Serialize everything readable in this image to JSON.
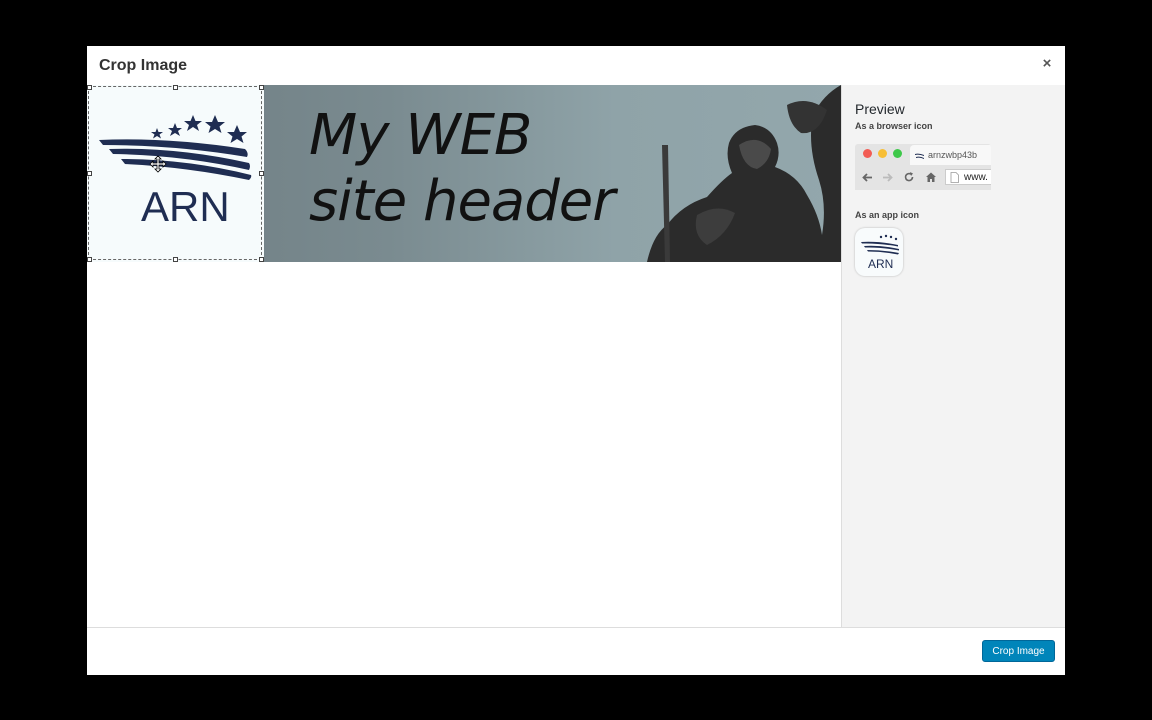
{
  "modal": {
    "title": "Crop Image",
    "close_glyph": "×"
  },
  "image": {
    "banner_line1": "My WEB",
    "banner_line2": "site header",
    "logo_text": "ARN"
  },
  "preview": {
    "title": "Preview",
    "browser_label": "As a browser icon",
    "tab_text": "arnzwbp43b",
    "url_text": "www.",
    "app_label": "As an app icon",
    "app_icon_text": "ARN"
  },
  "footer": {
    "crop_button": "Crop Image"
  },
  "colors": {
    "primary_button": "#0085ba",
    "logo_navy": "#1f2d52",
    "mac_red": "#f25c54",
    "mac_yellow": "#f7be35",
    "mac_green": "#3ec84a"
  },
  "icons": [
    "close-icon",
    "move-cursor-icon",
    "back-arrow-icon",
    "forward-arrow-icon",
    "reload-icon",
    "home-icon",
    "page-icon"
  ]
}
